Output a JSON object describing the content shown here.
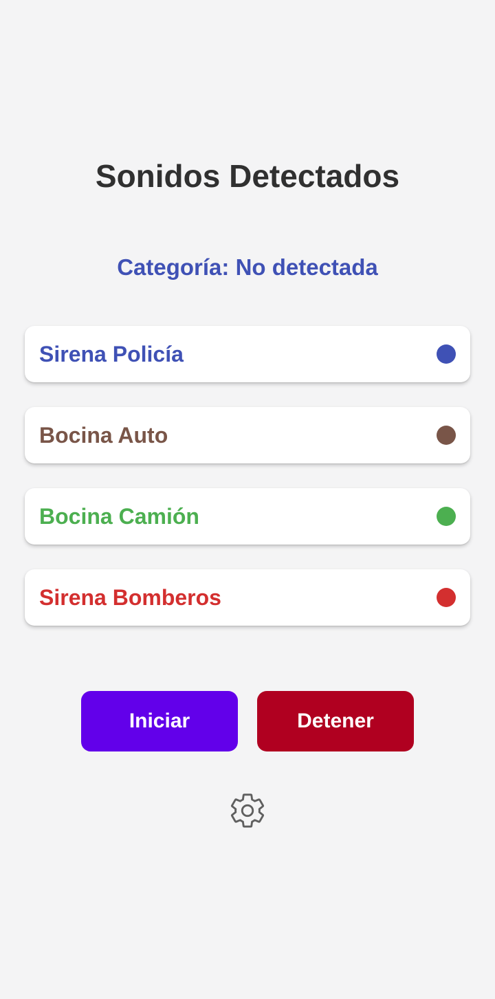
{
  "header": {
    "title": "Sonidos Detectados"
  },
  "status": {
    "category_text": "Categoría: No detectada",
    "color": "#3f51b5"
  },
  "sounds": [
    {
      "label": "Sirena Policía",
      "color": "#3f51b5"
    },
    {
      "label": "Bocina Auto",
      "color": "#795548"
    },
    {
      "label": "Bocina Camión",
      "color": "#4caf50"
    },
    {
      "label": "Sirena Bomberos",
      "color": "#d32f2f"
    }
  ],
  "actions": {
    "start_label": "Iniciar",
    "start_color": "#6200ea",
    "stop_label": "Detener",
    "stop_color": "#b00020"
  },
  "settings": {
    "icon": "gear-icon"
  },
  "theme": {
    "background": "#f4f4f5",
    "title_color": "#303030"
  }
}
